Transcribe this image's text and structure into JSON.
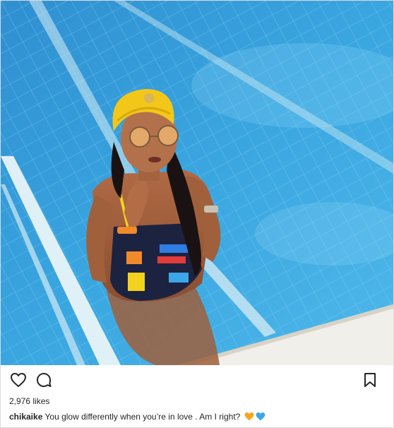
{
  "post": {
    "likes_text": "2,976 likes",
    "caption": {
      "username": "chikaike",
      "text": "You glow differently when you’re in love . Am I right?"
    }
  },
  "icons": {
    "like": "heart-outline-icon",
    "comment": "comment-bubble-icon",
    "save": "bookmark-icon",
    "emoji_1": "yellow-heart-emoji",
    "emoji_2": "blue-heart-emoji"
  },
  "colors": {
    "pool_water": "#3aa6e0",
    "turban": "#f2c71a",
    "text": "#262626",
    "border": "#dbdbdb"
  }
}
